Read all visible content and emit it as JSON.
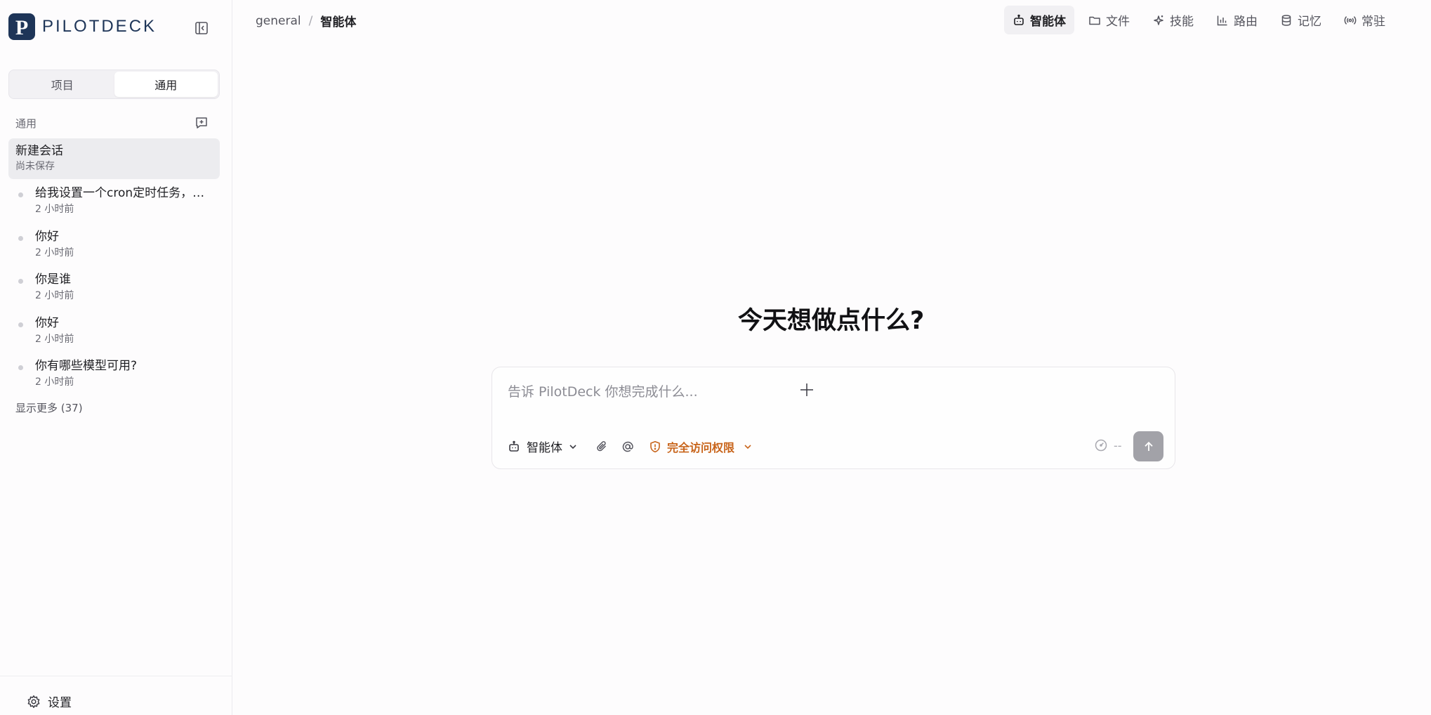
{
  "brand": {
    "name": "PILOTDECK",
    "logo_letter": "P",
    "color": "#1e3558"
  },
  "sidebar": {
    "segments": [
      {
        "label": "项目",
        "active": false
      },
      {
        "label": "通用",
        "active": true
      }
    ],
    "section_title": "通用",
    "current_chat": {
      "title": "新建会话",
      "subtitle": "尚未保存"
    },
    "history": [
      {
        "title": "给我设置一个cron定时任务，每...",
        "time": "2 小时前"
      },
      {
        "title": "你好",
        "time": "2 小时前"
      },
      {
        "title": "你是谁",
        "time": "2 小时前"
      },
      {
        "title": "你好",
        "time": "2 小时前"
      },
      {
        "title": "你有哪些模型可用?",
        "time": "2 小时前"
      }
    ],
    "show_more": "显示更多 (37)",
    "settings_label": "设置"
  },
  "breadcrumb": {
    "parent": "general",
    "separator": "/",
    "current": "智能体"
  },
  "topnav": {
    "tabs": [
      {
        "label": "智能体",
        "icon": "robot-icon",
        "active": true
      },
      {
        "label": "文件",
        "icon": "folder-icon",
        "active": false
      },
      {
        "label": "技能",
        "icon": "sparkle-icon",
        "active": false
      },
      {
        "label": "路由",
        "icon": "bar-chart-icon",
        "active": false
      },
      {
        "label": "记忆",
        "icon": "database-icon",
        "active": false
      },
      {
        "label": "常驻",
        "icon": "broadcast-icon",
        "active": false
      }
    ]
  },
  "main": {
    "headline": "今天想做点什么?",
    "composer": {
      "placeholder": "告诉 PilotDeck 你想完成什么...",
      "agent_label": "智能体",
      "permission_label": "完全访问权限",
      "permission_color": "#c8641a",
      "meter_value": "--"
    }
  }
}
